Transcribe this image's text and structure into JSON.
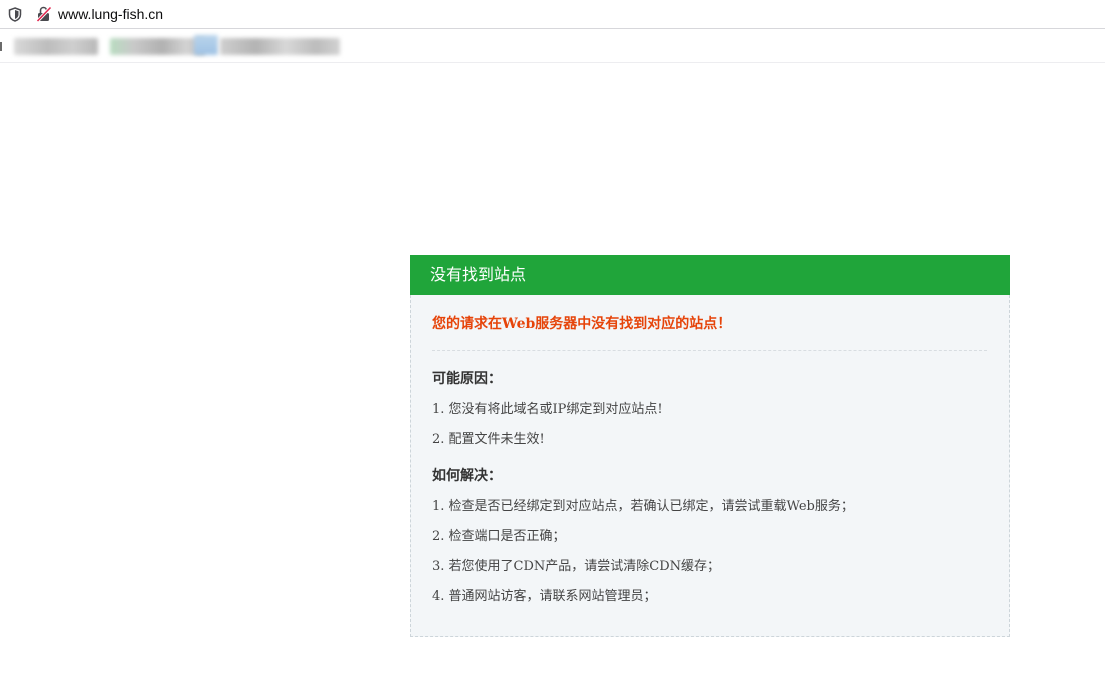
{
  "browser": {
    "url": "www.lung-fish.cn"
  },
  "panel": {
    "header_title": "没有找到站点",
    "error_message": "您的请求在Web服务器中没有找到对应的站点！",
    "causes_title": "可能原因：",
    "causes": [
      "1. 您没有将此域名或IP绑定到对应站点!",
      "2. 配置文件未生效!"
    ],
    "solutions_title": "如何解决：",
    "solutions": [
      "1. 检查是否已经绑定到对应站点，若确认已绑定，请尝试重载Web服务；",
      "2. 检查端口是否正确；",
      "3. 若您使用了CDN产品，请尝试清除CDN缓存；",
      "4. 普通网站访客，请联系网站管理员；"
    ]
  },
  "colors": {
    "header_green": "#20a53a",
    "error_orange": "#e6440a",
    "panel_bg": "#f3f6f8"
  }
}
